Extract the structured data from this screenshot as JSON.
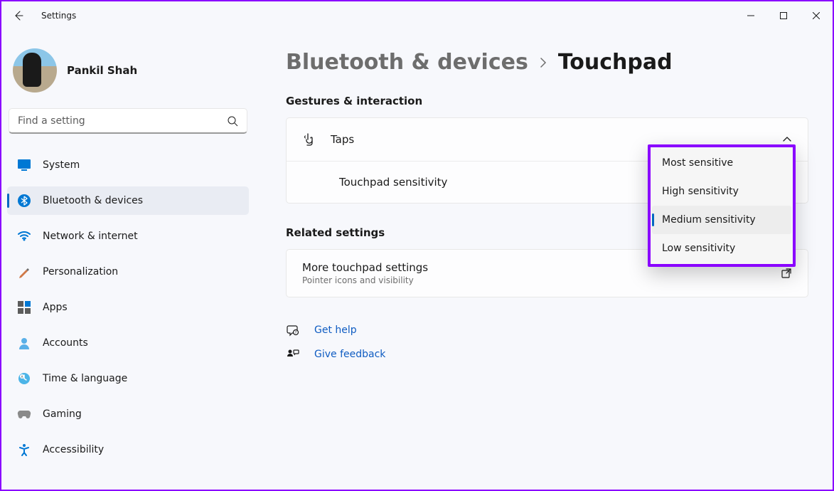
{
  "title": "Settings",
  "user": {
    "name": "Pankil Shah"
  },
  "search": {
    "placeholder": "Find a setting"
  },
  "nav": [
    {
      "icon": "system",
      "label": "System"
    },
    {
      "icon": "bluetooth",
      "label": "Bluetooth & devices",
      "active": true
    },
    {
      "icon": "network",
      "label": "Network & internet"
    },
    {
      "icon": "personalization",
      "label": "Personalization"
    },
    {
      "icon": "apps",
      "label": "Apps"
    },
    {
      "icon": "accounts",
      "label": "Accounts"
    },
    {
      "icon": "time",
      "label": "Time & language"
    },
    {
      "icon": "gaming",
      "label": "Gaming"
    },
    {
      "icon": "accessibility",
      "label": "Accessibility"
    }
  ],
  "breadcrumb": {
    "parent": "Bluetooth & devices",
    "current": "Touchpad"
  },
  "sections": {
    "gestures": {
      "title": "Gestures & interaction",
      "taps_label": "Taps",
      "sensitivity_label": "Touchpad sensitivity"
    },
    "related": {
      "title": "Related settings",
      "more_title": "More touchpad settings",
      "more_sub": "Pointer icons and visibility"
    }
  },
  "dropdown": {
    "options": [
      "Most sensitive",
      "High sensitivity",
      "Medium sensitivity",
      "Low sensitivity"
    ],
    "selected": "Medium sensitivity"
  },
  "help": {
    "get_help": "Get help",
    "feedback": "Give feedback"
  }
}
